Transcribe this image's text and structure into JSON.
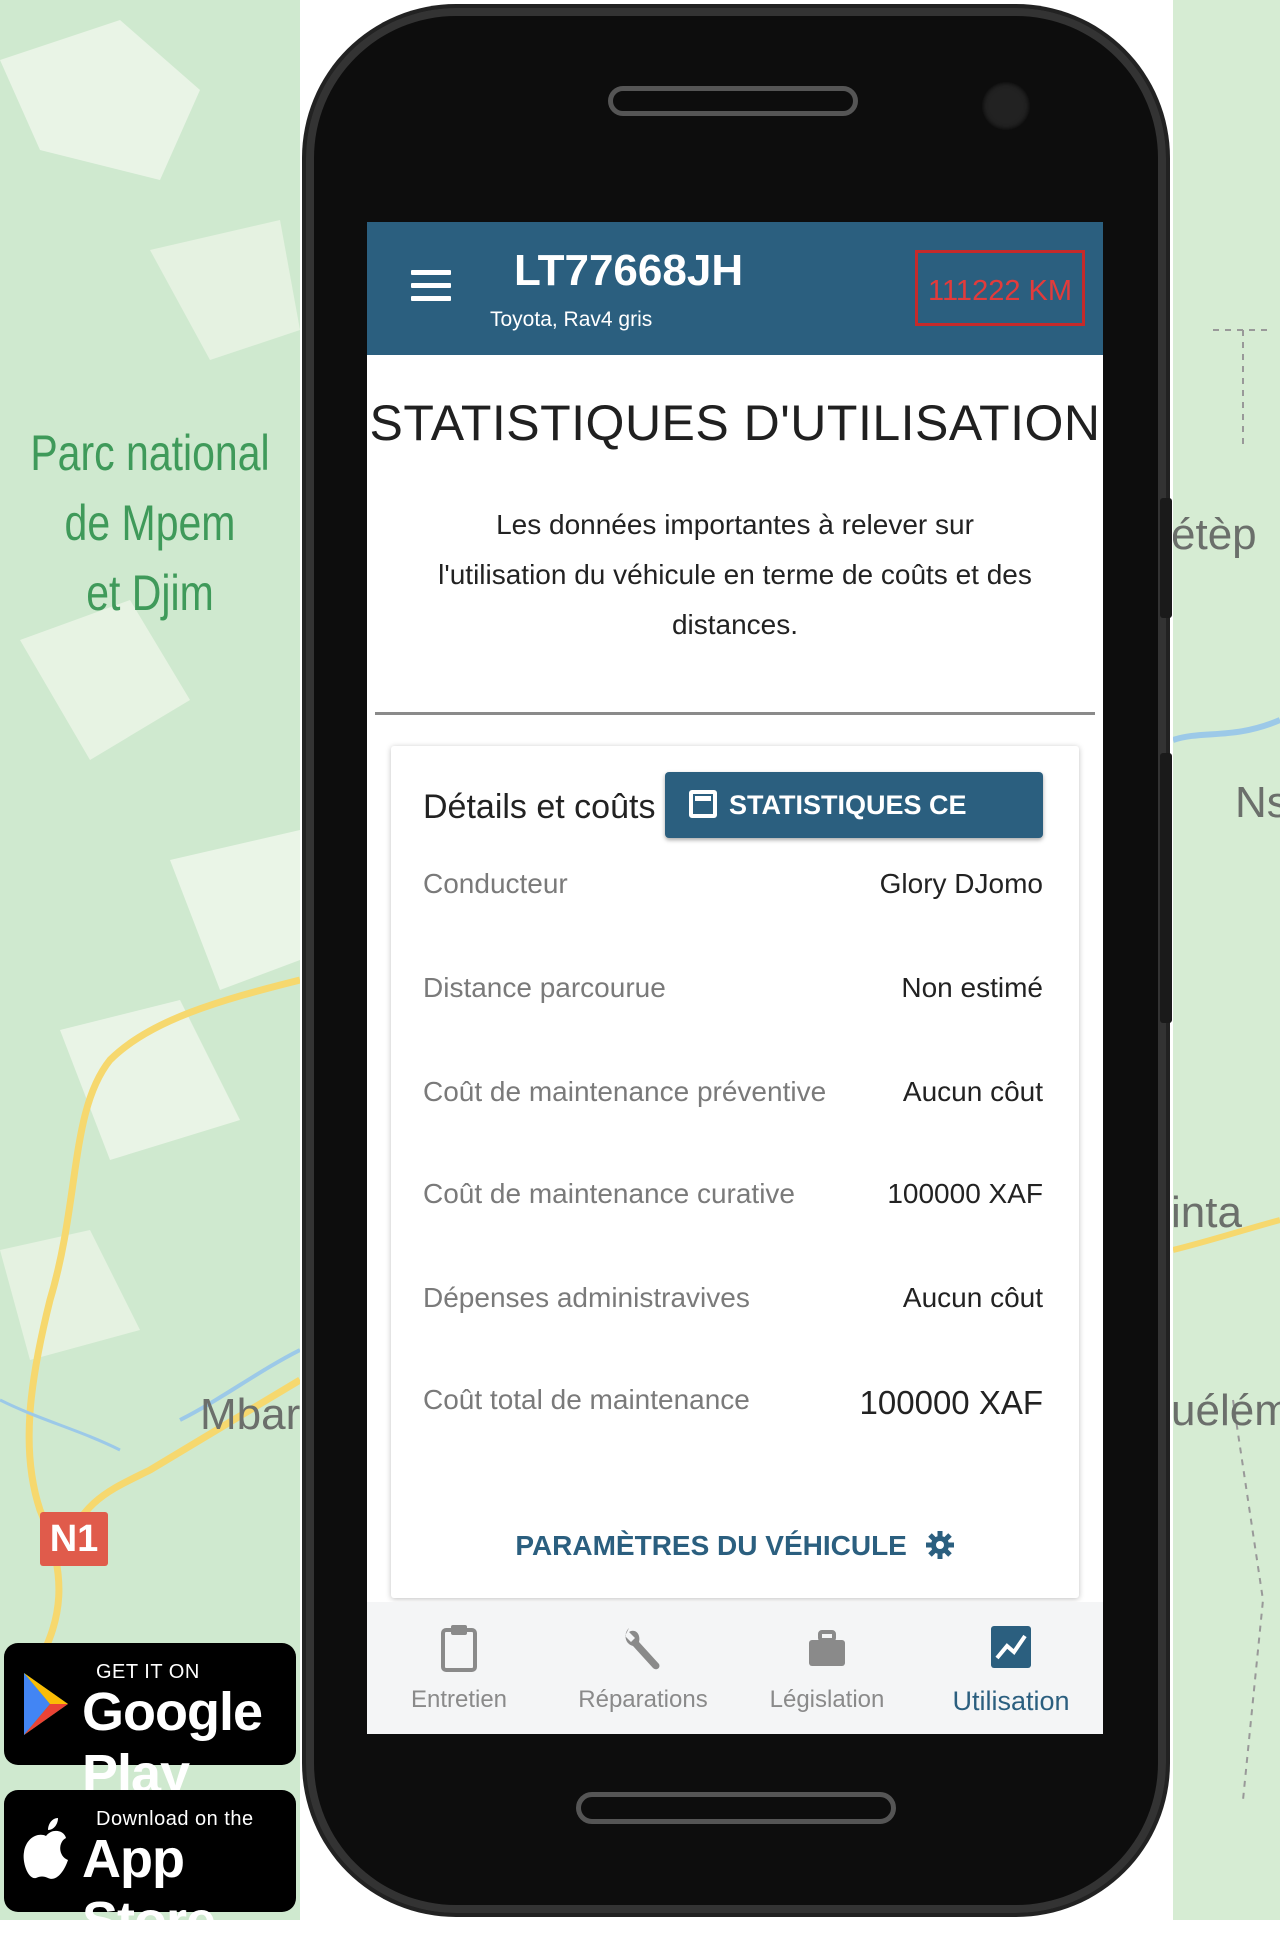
{
  "map": {
    "park_label_lines": [
      "Parc national",
      "de Mpem",
      "et Djim"
    ],
    "town_left": "Mbar",
    "road_badge": "N1",
    "right_labels": [
      "étèp",
      "Ns",
      "inta",
      "uélém"
    ]
  },
  "stores": {
    "google_play": {
      "small": "GET IT ON",
      "big": "Google Play"
    },
    "app_store": {
      "small": "Download on the",
      "big": "App Store"
    }
  },
  "appbar": {
    "plate": "LT77668JH",
    "model": "Toyota, Rav4 gris",
    "odometer": "111222 KM"
  },
  "page": {
    "title": "STATISTIQUES D'UTILISATION",
    "intro": "Les données importantes à relever sur l'utilisation du véhicule en terme de coûts et des distances."
  },
  "card": {
    "title": "Détails et coûts",
    "stats_button": "STATISTIQUES CE MOIS",
    "rows": [
      {
        "label": "Conducteur",
        "value": "Glory DJomo"
      },
      {
        "label": "Distance parcourue",
        "value": "Non estimé"
      },
      {
        "label": "Coût de maintenance préventive",
        "value": "Aucun côut"
      },
      {
        "label": "Coût de maintenance curative",
        "value": "100000 XAF"
      },
      {
        "label": "Dépenses administravives",
        "value": "Aucun côut"
      },
      {
        "label": "Coût total de maintenance",
        "value": "100000 XAF"
      }
    ],
    "settings_link": "PARAMÈTRES DU VÉHICULE"
  },
  "nav": [
    {
      "label": "Entretien",
      "icon": "clipboard-icon",
      "active": false
    },
    {
      "label": "Réparations",
      "icon": "wrench-icon",
      "active": false
    },
    {
      "label": "Législation",
      "icon": "briefcase-icon",
      "active": false
    },
    {
      "label": "Utilisation",
      "icon": "chart-icon",
      "active": true
    }
  ],
  "colors": {
    "primary": "#2b5f7f",
    "odometer": "#e23b3b",
    "map_green": "#cfe9cf"
  }
}
